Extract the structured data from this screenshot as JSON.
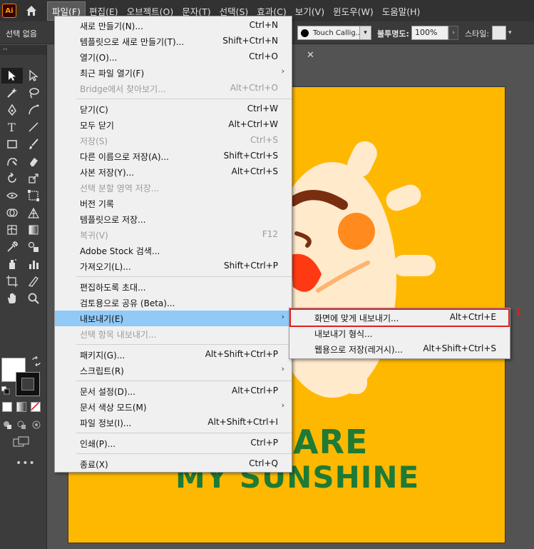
{
  "app": {
    "logo": "Ai"
  },
  "menubar": {
    "items": [
      "파일(F)",
      "편집(E)",
      "오브젝트(O)",
      "문자(T)",
      "선택(S)",
      "효과(C)",
      "보기(V)",
      "윈도우(W)",
      "도움말(H)"
    ],
    "active_index": 0
  },
  "controlbar": {
    "selection_label": "선택 없음",
    "brush_name": "Touch Callig...",
    "opacity_label": "불투명도:",
    "opacity_value": "100%",
    "style_label": "스타일:"
  },
  "file_menu": {
    "items": [
      {
        "label": "새로 만들기(N)...",
        "shortcut": "Ctrl+N",
        "disabled": false,
        "submenu": false
      },
      {
        "label": "템플릿으로 새로 만들기(T)...",
        "shortcut": "Shift+Ctrl+N",
        "disabled": false,
        "submenu": false
      },
      {
        "label": "열기(O)...",
        "shortcut": "Ctrl+O",
        "disabled": false,
        "submenu": false
      },
      {
        "label": "최근 파일 열기(F)",
        "shortcut": "",
        "disabled": false,
        "submenu": true
      },
      {
        "label": "Bridge에서 찾아보기...",
        "shortcut": "Alt+Ctrl+O",
        "disabled": true,
        "submenu": false
      },
      {
        "label": "닫기(C)",
        "shortcut": "Ctrl+W",
        "disabled": false,
        "submenu": false
      },
      {
        "label": "모두 닫기",
        "shortcut": "Alt+Ctrl+W",
        "disabled": false,
        "submenu": false
      },
      {
        "label": "저장(S)",
        "shortcut": "Ctrl+S",
        "disabled": true,
        "submenu": false
      },
      {
        "label": "다른 이름으로 저장(A)...",
        "shortcut": "Shift+Ctrl+S",
        "disabled": false,
        "submenu": false
      },
      {
        "label": "사본 저장(Y)...",
        "shortcut": "Alt+Ctrl+S",
        "disabled": false,
        "submenu": false
      },
      {
        "label": "선택 분할 영역 저장...",
        "shortcut": "",
        "disabled": true,
        "submenu": false
      },
      {
        "label": "버전 기록",
        "shortcut": "",
        "disabled": false,
        "submenu": false
      },
      {
        "label": "템플릿으로 저장...",
        "shortcut": "",
        "disabled": false,
        "submenu": false
      },
      {
        "label": "복귀(V)",
        "shortcut": "F12",
        "disabled": true,
        "submenu": false
      },
      {
        "label": "Adobe Stock 검색...",
        "shortcut": "",
        "disabled": false,
        "submenu": false
      },
      {
        "label": "가져오기(L)...",
        "shortcut": "Shift+Ctrl+P",
        "disabled": false,
        "submenu": false
      },
      {
        "label": "편집하도록 초대...",
        "shortcut": "",
        "disabled": false,
        "submenu": false
      },
      {
        "label": "검토용으로 공유 (Beta)...",
        "shortcut": "",
        "disabled": false,
        "submenu": false
      },
      {
        "label": "내보내기(E)",
        "shortcut": "",
        "disabled": false,
        "submenu": true,
        "highlight": true
      },
      {
        "label": "선택 항목 내보내기...",
        "shortcut": "",
        "disabled": true,
        "submenu": false
      },
      {
        "label": "패키지(G)...",
        "shortcut": "Alt+Shift+Ctrl+P",
        "disabled": false,
        "submenu": false
      },
      {
        "label": "스크립트(R)",
        "shortcut": "",
        "disabled": false,
        "submenu": true
      },
      {
        "label": "문서 설정(D)...",
        "shortcut": "Alt+Ctrl+P",
        "disabled": false,
        "submenu": false
      },
      {
        "label": "문서 색상 모드(M)",
        "shortcut": "",
        "disabled": false,
        "submenu": true
      },
      {
        "label": "파일 정보(I)...",
        "shortcut": "Alt+Shift+Ctrl+I",
        "disabled": false,
        "submenu": false
      },
      {
        "label": "인쇄(P)...",
        "shortcut": "Ctrl+P",
        "disabled": false,
        "submenu": false
      },
      {
        "label": "종료(X)",
        "shortcut": "Ctrl+Q",
        "disabled": false,
        "submenu": false
      }
    ]
  },
  "export_submenu": {
    "items": [
      {
        "label": "화면에 맞게 내보내기...",
        "shortcut": "Alt+Ctrl+E"
      },
      {
        "label": "내보내기 형식...",
        "shortcut": ""
      },
      {
        "label": "웹용으로 저장(레거시)...",
        "shortcut": "Alt+Shift+Ctrl+S"
      }
    ],
    "step_marker": "1"
  },
  "artboard": {
    "background": "#FFB800",
    "text_line1": "ARE",
    "text_line2": "MY SUNSHINE",
    "text_color": "#1E7A34"
  },
  "colors": {
    "accent_highlight": "#91c9f7",
    "annotation_red": "#e02020"
  }
}
